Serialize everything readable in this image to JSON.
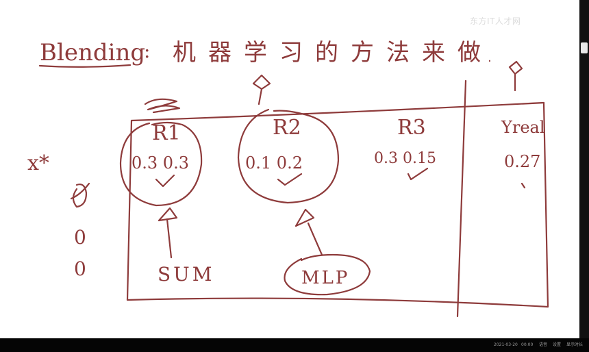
{
  "whiteboard": {
    "title": "Blending",
    "title_colon": ":",
    "subtitle": "机器学习的方法来做",
    "trailing_dot": ".",
    "x_star": "x*",
    "columns": [
      {
        "label": "R1",
        "values": "0.3 0.3"
      },
      {
        "label": "R2",
        "values": "0.1 0.2"
      },
      {
        "label": "R3",
        "values": "0.3 0.15"
      },
      {
        "label": "Yreal",
        "values": "0.27"
      }
    ],
    "row_marks": [
      "0",
      "0",
      "0"
    ],
    "sum_label": "SUM",
    "mlp_label": "MLP"
  },
  "watermark": {
    "text": "东方IT人才网"
  },
  "taskbar": {
    "items": [
      "2021-03-20",
      "00:00",
      "语音",
      "设置",
      "显示时长"
    ]
  },
  "colors": {
    "ink": "#8e3b3b",
    "board": "#ffffff",
    "frame": "#000000"
  }
}
